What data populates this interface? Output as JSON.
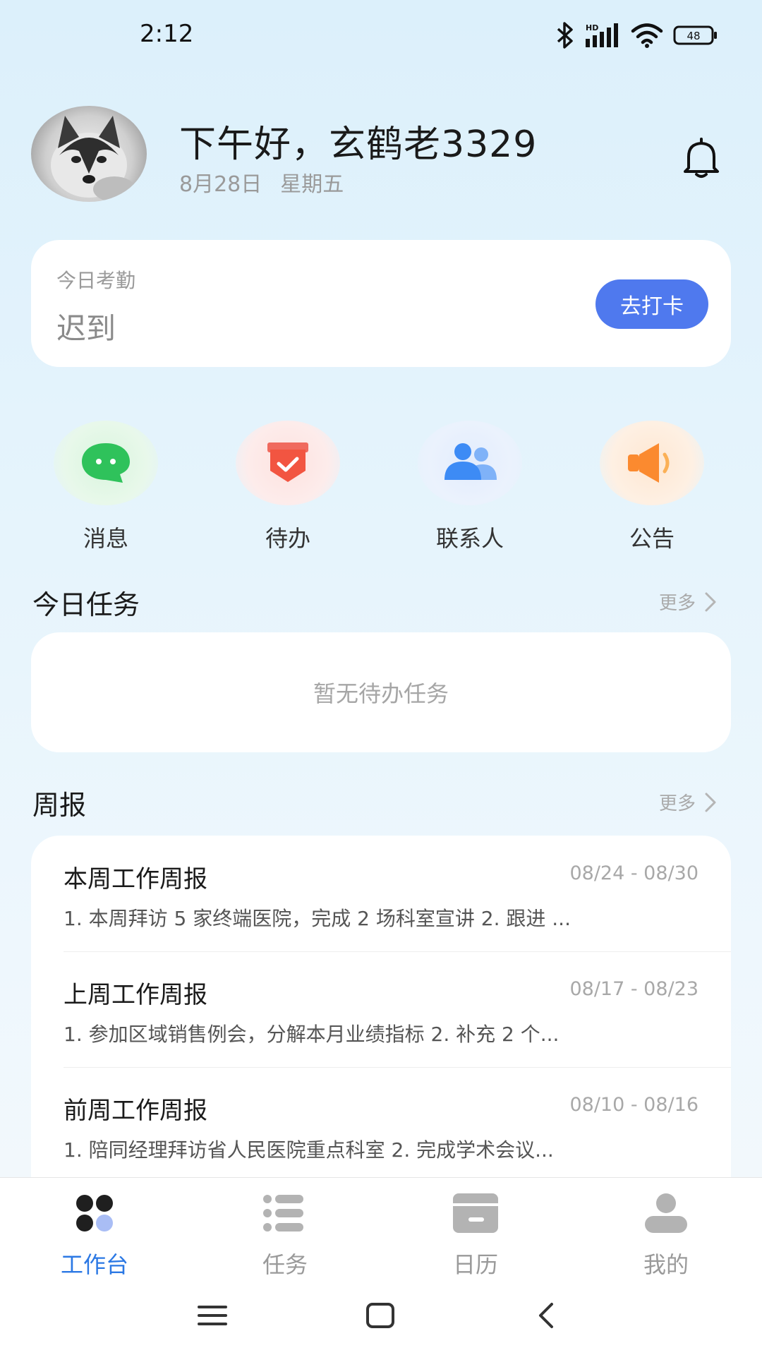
{
  "status_bar": {
    "time": "2:12",
    "battery": "48",
    "icons": [
      "bluetooth-icon",
      "signal-icon",
      "wifi-icon",
      "battery-icon"
    ]
  },
  "header": {
    "greeting": "下午好，玄鹤老3329",
    "date": "8月28日",
    "weekday": "星期五"
  },
  "attendance": {
    "label": "今日考勤",
    "status": "迟到",
    "button": "去打卡"
  },
  "quick_actions": [
    {
      "label": "消息",
      "icon": "chat-bubble-icon",
      "color": "#2fc25b"
    },
    {
      "label": "待办",
      "icon": "todo-check-icon",
      "color": "#f25541"
    },
    {
      "label": "联系人",
      "icon": "contacts-icon",
      "color": "#3d8bf5"
    },
    {
      "label": "公告",
      "icon": "megaphone-icon",
      "color": "#fb8a2f"
    }
  ],
  "tasks": {
    "title": "今日任务",
    "more": "更多",
    "empty": "暂无待办任务"
  },
  "weekly": {
    "title": "周报",
    "more": "更多",
    "items": [
      {
        "title": "本周工作周报",
        "range": "08/24 - 08/30",
        "summary": "1. 本周拜访 5 家终端医院，完成 2 场科室宣讲 2. 跟进 ..."
      },
      {
        "title": "上周工作周报",
        "range": "08/17 - 08/23",
        "summary": "1. 参加区域销售例会，分解本月业绩指标 2. 补充 2 个..."
      },
      {
        "title": "前周工作周报",
        "range": "08/10 - 08/16",
        "summary": "1. 陪同经理拜访省人民医院重点科室 2. 完成学术会议..."
      }
    ]
  },
  "tabbar": [
    {
      "label": "工作台",
      "icon": "workbench-icon",
      "active": true
    },
    {
      "label": "任务",
      "icon": "list-icon",
      "active": false
    },
    {
      "label": "日历",
      "icon": "calendar-icon",
      "active": false
    },
    {
      "label": "我的",
      "icon": "profile-icon",
      "active": false
    }
  ],
  "colors": {
    "accent": "#4f79ee",
    "tab_active": "#2b78e4"
  }
}
